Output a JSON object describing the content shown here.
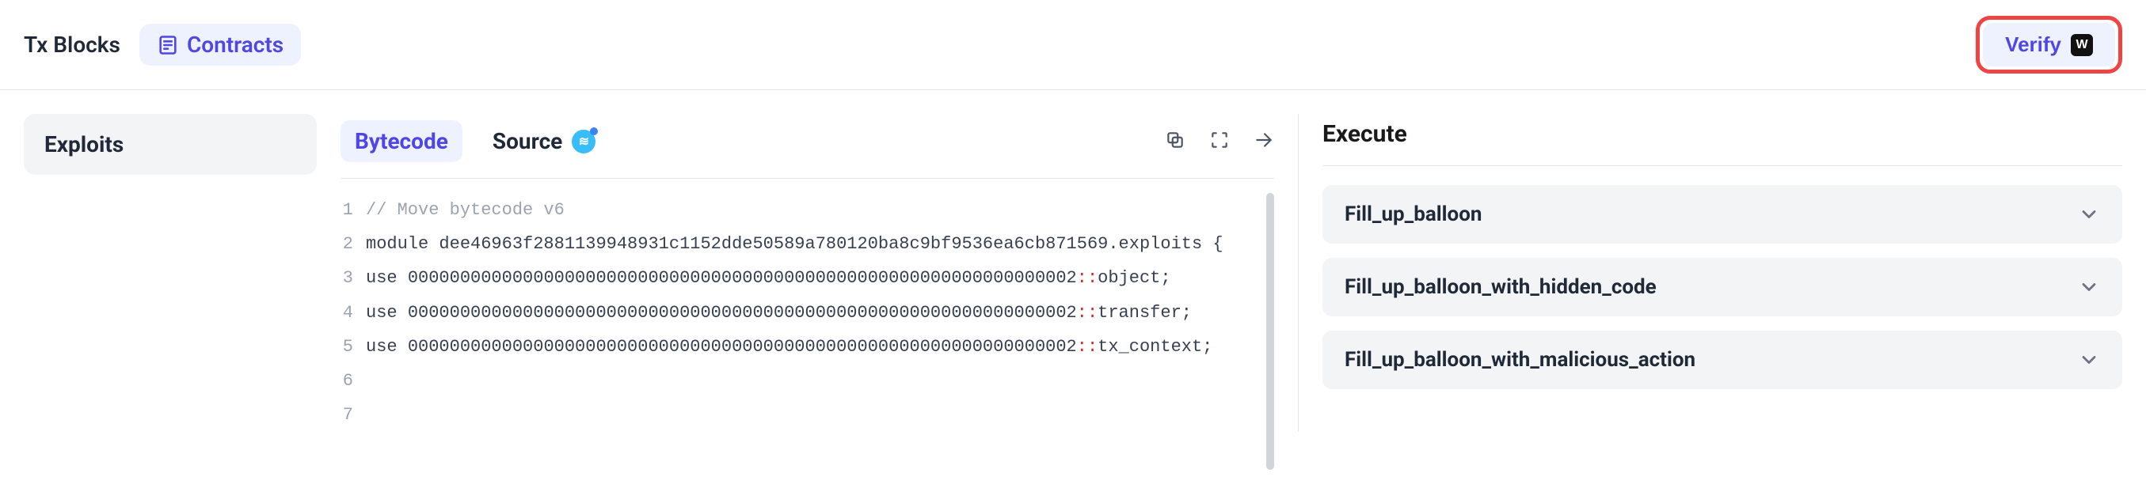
{
  "header": {
    "txblocks_label": "Tx Blocks",
    "contracts_label": "Contracts",
    "verify_label": "Verify",
    "verify_badge_glyph": "W"
  },
  "sidebar": {
    "items": [
      {
        "label": "Exploits"
      }
    ]
  },
  "codeview": {
    "tabs": {
      "bytecode_label": "Bytecode",
      "source_label": "Source",
      "source_badge_glyph": "≋"
    },
    "lines": [
      {
        "n": "1",
        "segments": [
          {
            "cls": "cmt",
            "text": "// Move bytecode v6"
          }
        ]
      },
      {
        "n": "2",
        "segments": [
          {
            "cls": "",
            "text": "module dee46963f2881139948931c1152dde50589a780120ba8c9bf9536ea6cb871569.exploits {"
          }
        ]
      },
      {
        "n": "3",
        "segments": [
          {
            "cls": "",
            "text": "use "
          },
          {
            "cls": "addr",
            "text": "0000000000000000000000000000000000000000000000000000000000000002"
          },
          {
            "cls": "dblcolon",
            "text": "::"
          },
          {
            "cls": "",
            "text": "object;"
          }
        ]
      },
      {
        "n": "4",
        "segments": [
          {
            "cls": "",
            "text": "use "
          },
          {
            "cls": "addr",
            "text": "0000000000000000000000000000000000000000000000000000000000000002"
          },
          {
            "cls": "dblcolon",
            "text": "::"
          },
          {
            "cls": "",
            "text": "transfer;"
          }
        ]
      },
      {
        "n": "5",
        "segments": [
          {
            "cls": "",
            "text": "use "
          },
          {
            "cls": "addr",
            "text": "0000000000000000000000000000000000000000000000000000000000000002"
          },
          {
            "cls": "dblcolon",
            "text": "::"
          },
          {
            "cls": "",
            "text": "tx_context;"
          }
        ]
      },
      {
        "n": "6",
        "segments": []
      },
      {
        "n": "7",
        "segments": []
      }
    ]
  },
  "execute": {
    "title": "Execute",
    "items": [
      {
        "label": "Fill_up_balloon"
      },
      {
        "label": "Fill_up_balloon_with_hidden_code"
      },
      {
        "label": "Fill_up_balloon_with_malicious_action"
      }
    ]
  }
}
